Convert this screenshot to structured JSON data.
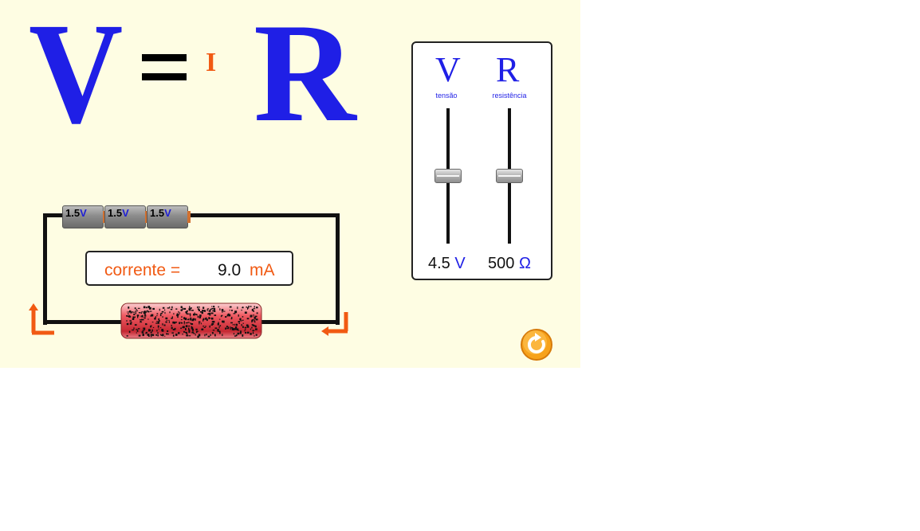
{
  "equation": {
    "v": "V",
    "equals": "=",
    "i": "I",
    "r": "R",
    "colors": {
      "v": "#1f1fe6",
      "i": "#f15a13",
      "r": "#1f1fe6"
    }
  },
  "circuit": {
    "batteries": [
      {
        "num": "1.5",
        "unit": "V"
      },
      {
        "num": "1.5",
        "unit": "V"
      },
      {
        "num": "1.5",
        "unit": "V"
      }
    ],
    "readout": {
      "label": "corrente =",
      "value": "9.0",
      "unit": "mA"
    },
    "resistor": "resistor",
    "arrows": [
      "current-arrow-left",
      "current-arrow-right"
    ]
  },
  "panel": {
    "voltage": {
      "symbol": "V",
      "caption": "tensão",
      "value_num": "4.5",
      "unit": "V",
      "level": 0.5
    },
    "resistance": {
      "symbol": "R",
      "caption": "resistência",
      "value_num": "500",
      "unit": "Ω",
      "level": 0.5
    }
  },
  "reset": {
    "icon": "reset-icon"
  },
  "colors": {
    "background": "#fefde3",
    "blue": "#1f1fe6",
    "orange": "#f15a13",
    "resistor": "#e94a54"
  }
}
